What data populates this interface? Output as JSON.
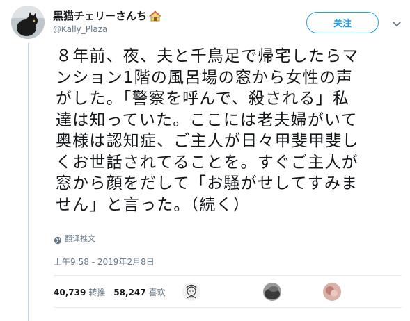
{
  "user": {
    "display_name": "黒猫チェリーさんち",
    "handle": "@Kally_Plaza",
    "name_icon": "house-icon"
  },
  "header": {
    "follow_label": "关注",
    "menu_icon": "chevron-down-icon"
  },
  "tweet": {
    "lines": [
      "８年前、夜、夫と千鳥足で帰宅したらマ",
      "ンション1階の風呂場の窓から女性の声",
      "がした。「警察を呼んで、殺される」私",
      "達は知っていた。ここには老夫婦がいて",
      "奥様は認知症、ご主人が日々甲斐甲斐し",
      "くお世話されてることを。すぐご主人が",
      "窓から顔をだして「お騒がせしてすみま",
      "せん」と言った。（続く）"
    ],
    "translate_label": "翻译推文",
    "timestamp": "上午9:58 - 2019年2月8日"
  },
  "stats": {
    "retweets_count": "40,739",
    "retweets_label": "转推",
    "likes_count": "58,247",
    "likes_label": "喜欢"
  },
  "colors": {
    "accent": "#1da1f2",
    "text": "#14171a",
    "muted": "#657786",
    "divider": "#e6ecf0"
  }
}
